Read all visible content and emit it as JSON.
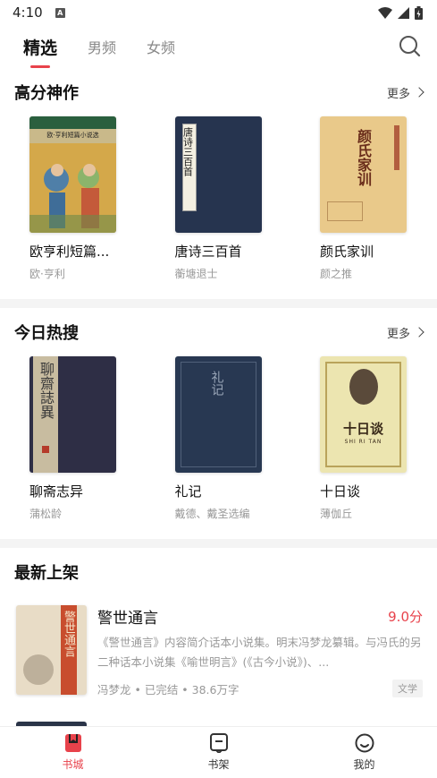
{
  "status": {
    "time": "4:10",
    "notif": "A"
  },
  "top_tabs": [
    "精选",
    "男频",
    "女频"
  ],
  "sections": {
    "high": {
      "title": "高分神作",
      "more": "更多",
      "books": [
        {
          "name": "欧亨利短篇...",
          "author": "欧·亨利",
          "cover_text": "欧·亨利短篇小说选"
        },
        {
          "name": "唐诗三百首",
          "author": "蘅塘退士",
          "cover_text": "唐诗三百首"
        },
        {
          "name": "颜氏家训",
          "author": "颜之推",
          "cover_text": "颜氏家训"
        }
      ]
    },
    "hot": {
      "title": "今日热搜",
      "more": "更多",
      "books": [
        {
          "name": "聊斋志异",
          "author": "蒲松龄",
          "cover_text": "聊齋誌異"
        },
        {
          "name": "礼记",
          "author": "戴德、戴圣选编",
          "cover_text": "礼记"
        },
        {
          "name": "十日谈",
          "author": "薄伽丘",
          "cover_text": "十日谈",
          "cover_sub": "SHI RI TAN"
        }
      ]
    },
    "newest": {
      "title": "最新上架",
      "item": {
        "title": "警世通言",
        "score": "9.0分",
        "desc": "《警世通言》内容简介话本小说集。明末冯梦龙纂辑。与冯氏的另二种话本小说集《喻世明言》(《古今小说》)、...",
        "meta": "冯梦龙 • 已完结 • 38.6万字",
        "tag": "文学",
        "cover_text": "警世通言"
      }
    }
  },
  "bottom_nav": [
    {
      "label": "书城",
      "icon": "book-city-icon",
      "active": true
    },
    {
      "label": "书架",
      "icon": "bookshelf-icon",
      "active": false
    },
    {
      "label": "我的",
      "icon": "profile-icon",
      "active": false
    }
  ],
  "colors": {
    "accent": "#e8424b"
  }
}
